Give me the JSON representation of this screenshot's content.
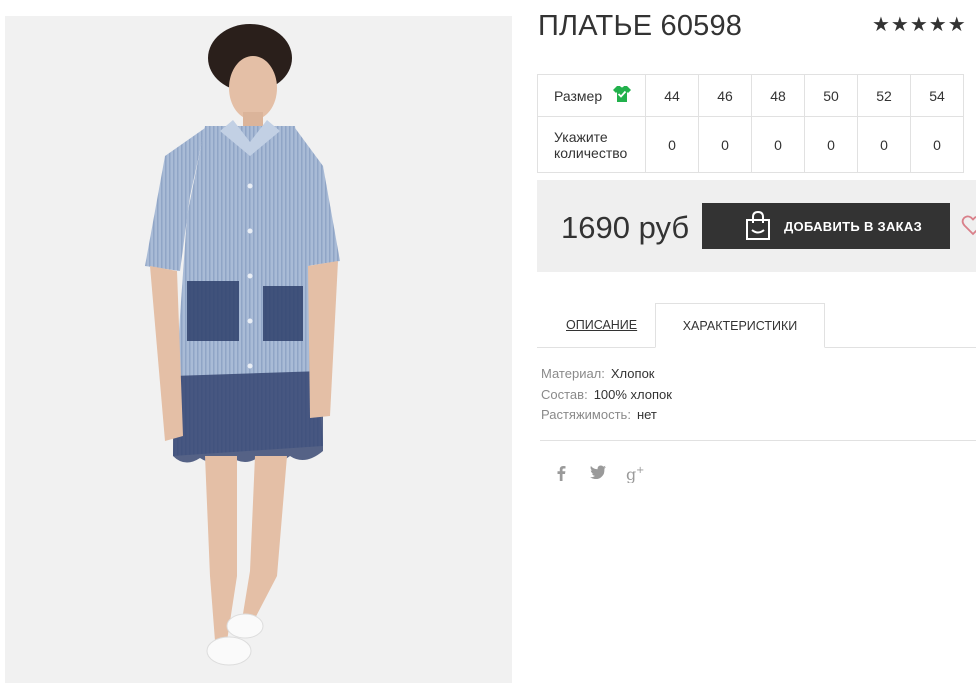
{
  "product": {
    "title": "ПЛАТЬЕ 60598",
    "rating_stars": "★★★★★"
  },
  "sizes": {
    "size_label": "Размер",
    "qty_label_line1": "Укажите",
    "qty_label_line2": "количество",
    "values": [
      "44",
      "46",
      "48",
      "50",
      "52",
      "54"
    ],
    "quantities": [
      "0",
      "0",
      "0",
      "0",
      "0",
      "0"
    ]
  },
  "buy": {
    "price": "1690 руб",
    "add_label": "ДОБАВИТЬ В ЗАКАЗ"
  },
  "tabs": {
    "description": "ОПИСАНИЕ",
    "characteristics": "ХАРАКТЕРИСТИКИ"
  },
  "characteristics": [
    {
      "key": "Материал:",
      "value": "Хлопок"
    },
    {
      "key": "Состав:",
      "value": "100% хлопок"
    },
    {
      "key": "Растяжимость:",
      "value": "нет"
    }
  ],
  "colors": {
    "button_bg": "#333333",
    "box_bg": "#efefef",
    "shirt_icon": "#22b14c",
    "heart": "#d9808a"
  },
  "icons": [
    "shirt-check-icon",
    "shopping-bag-icon",
    "heart-icon",
    "facebook-icon",
    "twitter-icon",
    "google-plus-icon"
  ]
}
